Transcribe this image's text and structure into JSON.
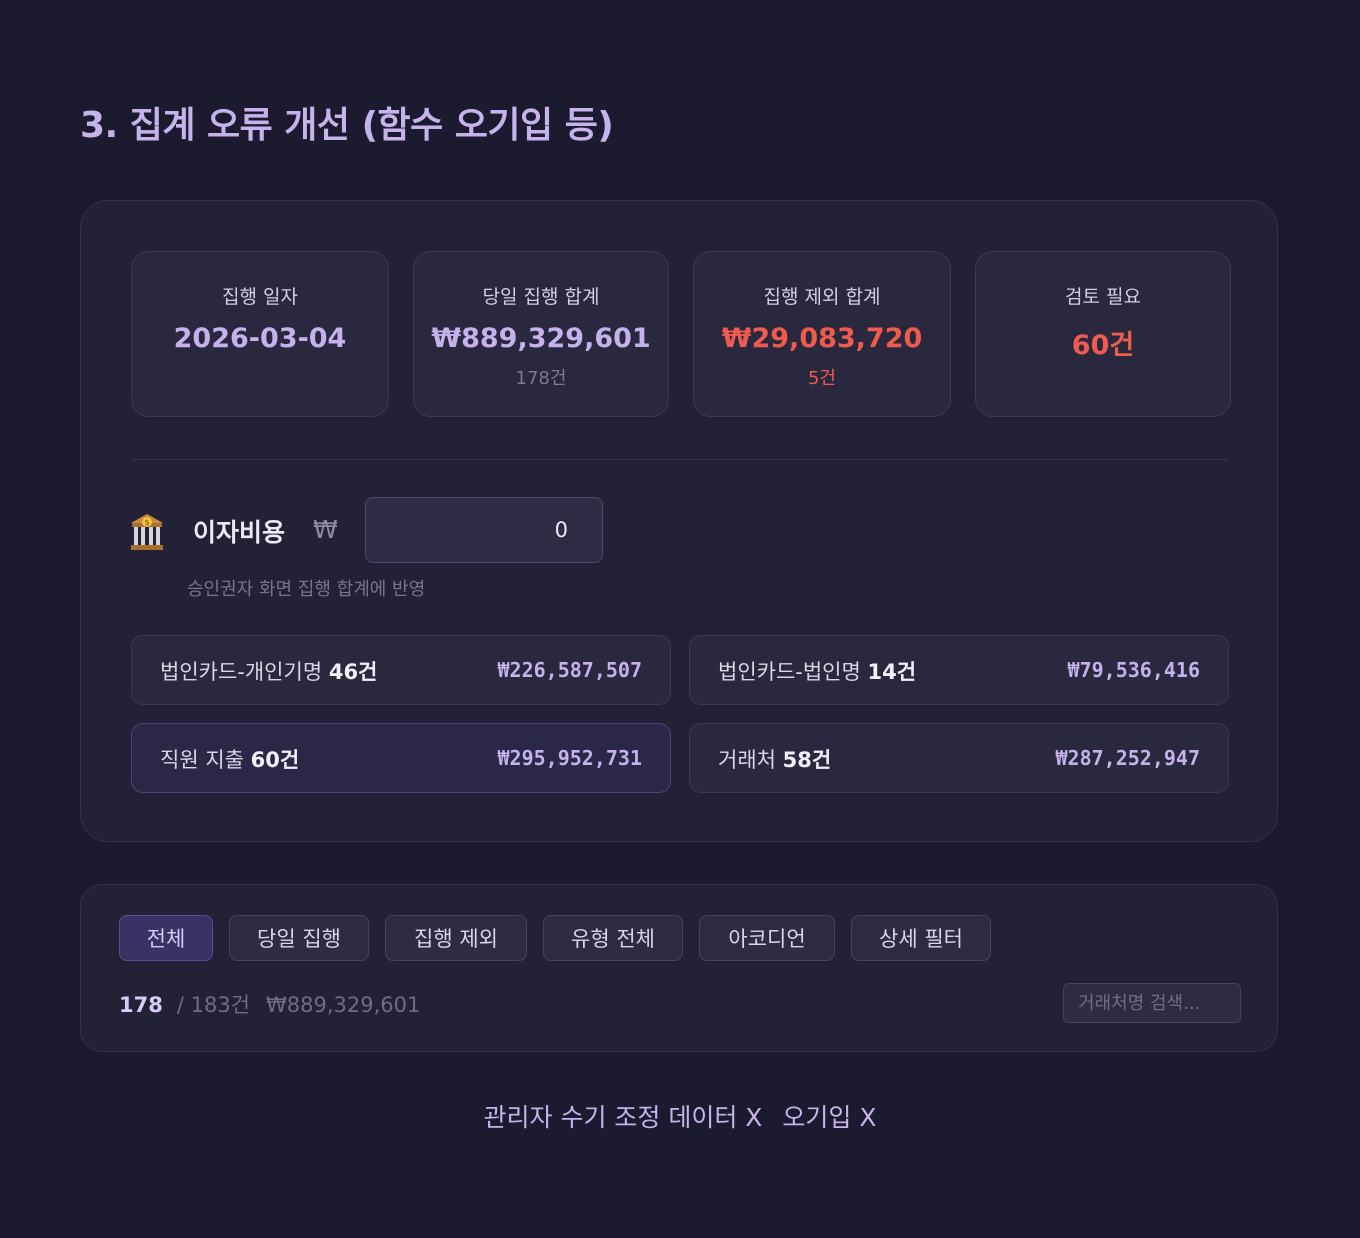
{
  "page_title": "3. 집계 오류 개선 (함수 오기입 등)",
  "stats": [
    {
      "label": "집행 일자",
      "value": "2026-03-04",
      "sub": ""
    },
    {
      "label": "당일 집행 합계",
      "value": "₩889,329,601",
      "sub": "178건"
    },
    {
      "label": "집행 제외 합계",
      "value": "₩29,083,720",
      "sub": "5건"
    },
    {
      "label": "검토 필요",
      "value": "60건",
      "sub": ""
    }
  ],
  "interest": {
    "icon": "bank-icon",
    "label": "이자비용",
    "currency": "₩",
    "value": "0",
    "note": "승인권자 화면 집행 합계에 반영"
  },
  "categories": [
    {
      "name": "법인카드-개인기명",
      "count": "46건",
      "amount": "₩226,587,507"
    },
    {
      "name": "법인카드-법인명",
      "count": "14건",
      "amount": "₩79,536,416"
    },
    {
      "name": "직원 지출",
      "count": "60건",
      "amount": "₩295,952,731"
    },
    {
      "name": "거래처",
      "count": "58건",
      "amount": "₩287,252,947"
    }
  ],
  "filters": {
    "chips": [
      "전체",
      "당일 집행",
      "집행 제외",
      "유형 전체",
      "아코디언",
      "상세 필터"
    ],
    "active": "전체",
    "count_current": "178",
    "count_total": "/ 183건",
    "amount": "₩889,329,601",
    "search_placeholder": "거래처명 검색..."
  },
  "footer": {
    "note1": "관리자 수기 조정 데이터 X",
    "note2": "오기입 X"
  },
  "colors": {
    "background": "#1b1a2e",
    "panel": "#222136",
    "accent": "#c5b2ec",
    "danger": "#ef5b4c"
  }
}
